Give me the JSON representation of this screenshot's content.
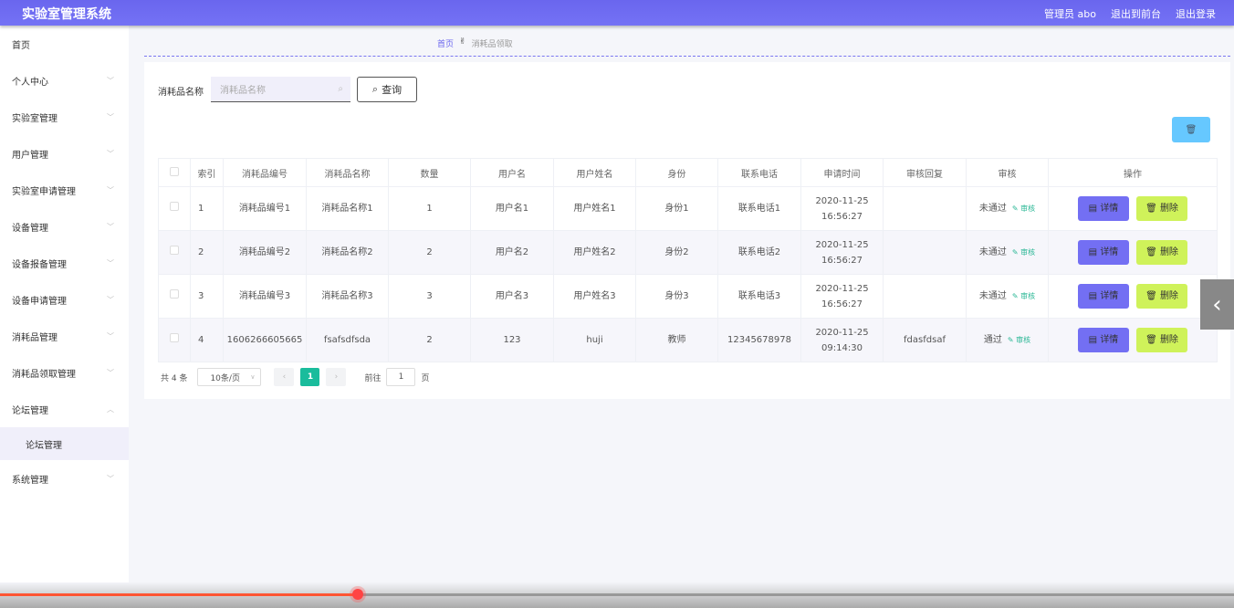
{
  "header": {
    "title": "实验室管理系统",
    "user": "管理员 abo",
    "to_front": "退出到前台",
    "logout": "退出登录"
  },
  "sidebar": {
    "items": [
      {
        "label": "首页",
        "chev": false
      },
      {
        "label": "个人中心",
        "chev": true
      },
      {
        "label": "实验室管理",
        "chev": true
      },
      {
        "label": "用户管理",
        "chev": true
      },
      {
        "label": "实验室申请管理",
        "chev": true
      },
      {
        "label": "设备管理",
        "chev": true
      },
      {
        "label": "设备报备管理",
        "chev": true
      },
      {
        "label": "设备申请管理",
        "chev": true
      },
      {
        "label": "消耗品管理",
        "chev": true
      },
      {
        "label": "消耗品领取管理",
        "chev": true
      },
      {
        "label": "论坛管理",
        "chev": true,
        "open": true
      }
    ],
    "sub": "论坛管理",
    "last": "系统管理"
  },
  "breadcrumb": {
    "home": "首页",
    "current": "消耗品领取"
  },
  "search": {
    "label": "消耗品名称",
    "placeholder": "消耗品名称",
    "button": "查询"
  },
  "table": {
    "headers": [
      "索引",
      "消耗品编号",
      "消耗品名称",
      "数量",
      "用户名",
      "用户姓名",
      "身份",
      "联系电话",
      "申请时间",
      "审核回复",
      "审核",
      "操作"
    ],
    "rows": [
      [
        "1",
        "消耗品编号1",
        "消耗品名称1",
        "1",
        "用户名1",
        "用户姓名1",
        "身份1",
        "联系电话1",
        "2020-11-25 16:56:27",
        "",
        "未通过"
      ],
      [
        "2",
        "消耗品编号2",
        "消耗品名称2",
        "2",
        "用户名2",
        "用户姓名2",
        "身份2",
        "联系电话2",
        "2020-11-25 16:56:27",
        "",
        "未通过"
      ],
      [
        "3",
        "消耗品编号3",
        "消耗品名称3",
        "3",
        "用户名3",
        "用户姓名3",
        "身份3",
        "联系电话3",
        "2020-11-25 16:56:27",
        "",
        "未通过"
      ],
      [
        "4",
        "1606266605665",
        "fsafsdfsda",
        "2",
        "123",
        "huji",
        "教师",
        "12345678978",
        "2020-11-25 09:14:30",
        "fdasfdsaf",
        "通过"
      ]
    ],
    "audit_label": "审核",
    "detail_label": "详情",
    "delete_label": "删除"
  },
  "pagination": {
    "total": "共 4 条",
    "page_size": "10条/页",
    "current_page": "1",
    "goto": "前往",
    "goto_value": "1",
    "page_suffix": "页"
  },
  "video": {
    "progress_percent": 29
  },
  "colors": {
    "header": "#6e6cf2",
    "detail": "#736ff3",
    "delete": "#cff25a",
    "bulk_delete": "#66c8ff",
    "active_page": "#1abc9c"
  }
}
